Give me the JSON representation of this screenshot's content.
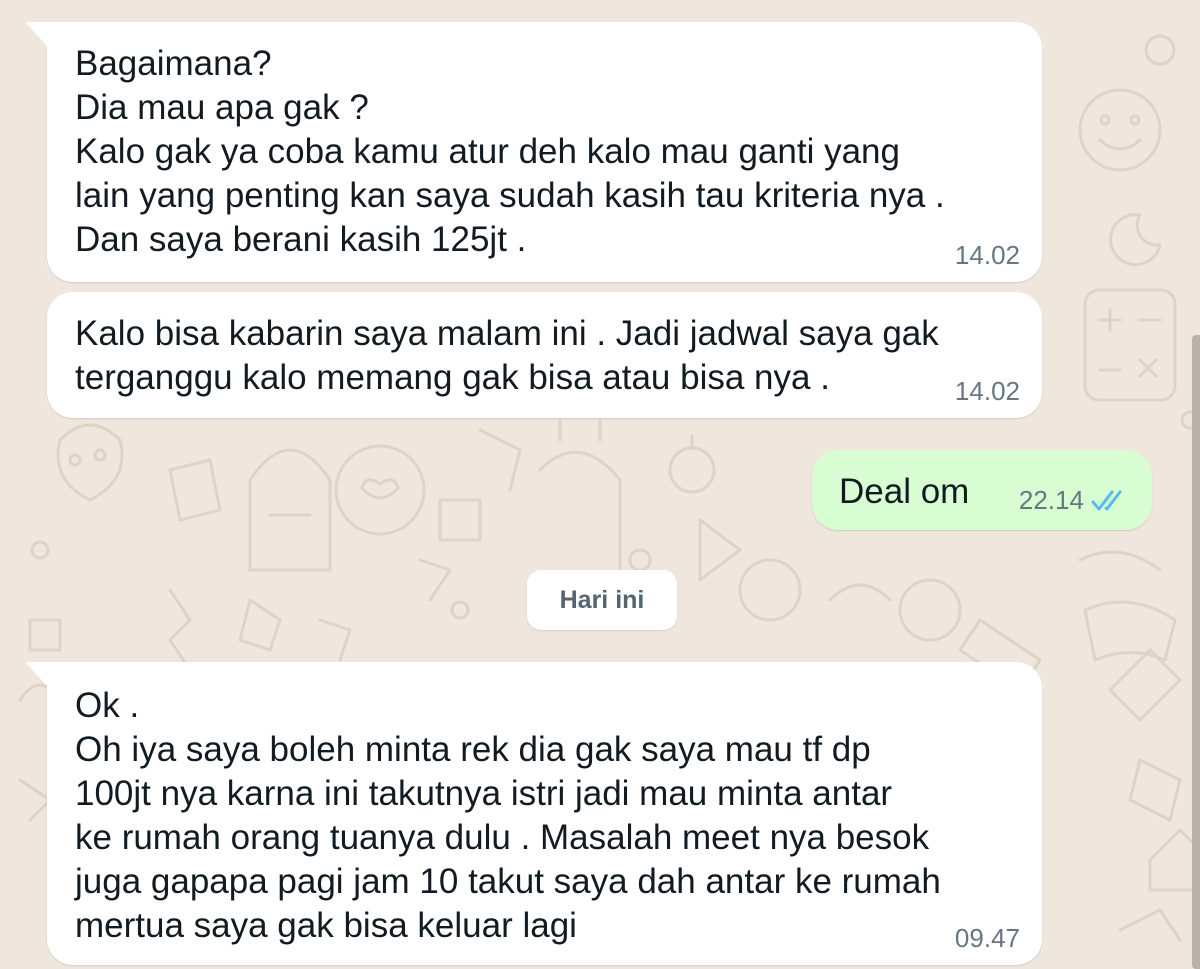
{
  "messages": [
    {
      "direction": "incoming",
      "text": "Bagaimana?\nDia mau apa gak ?\nKalo gak ya coba kamu atur deh kalo mau ganti yang\nlain yang penting kan saya sudah kasih tau kriteria nya .\nDan saya berani kasih 125jt .",
      "time": "14.02"
    },
    {
      "direction": "incoming",
      "text": "Kalo bisa kabarin saya malam ini . Jadi jadwal saya gak\nterganggu kalo memang gak bisa atau bisa nya .",
      "time": "14.02"
    },
    {
      "direction": "outgoing",
      "text": "Deal om",
      "time": "22.14",
      "status": "read"
    },
    {
      "direction": "incoming",
      "text": "Ok .\nOh iya saya boleh minta rek dia gak saya mau tf dp\n100jt nya karna ini takutnya istri jadi mau minta antar\nke rumah orang tuanya dulu . Masalah meet nya besok\njuga gapapa pagi jam 10 takut saya dah antar ke rumah\nmertua saya gak bisa keluar lagi",
      "time": "09.47"
    }
  ],
  "date_divider": "Hari ini",
  "colors": {
    "background": "#efe7dd",
    "incoming_bubble": "#ffffff",
    "outgoing_bubble": "#d9fdd3",
    "read_ticks": "#53bdeb",
    "time_text": "#667781"
  },
  "icons": {
    "read_receipt": "double-check-icon"
  }
}
